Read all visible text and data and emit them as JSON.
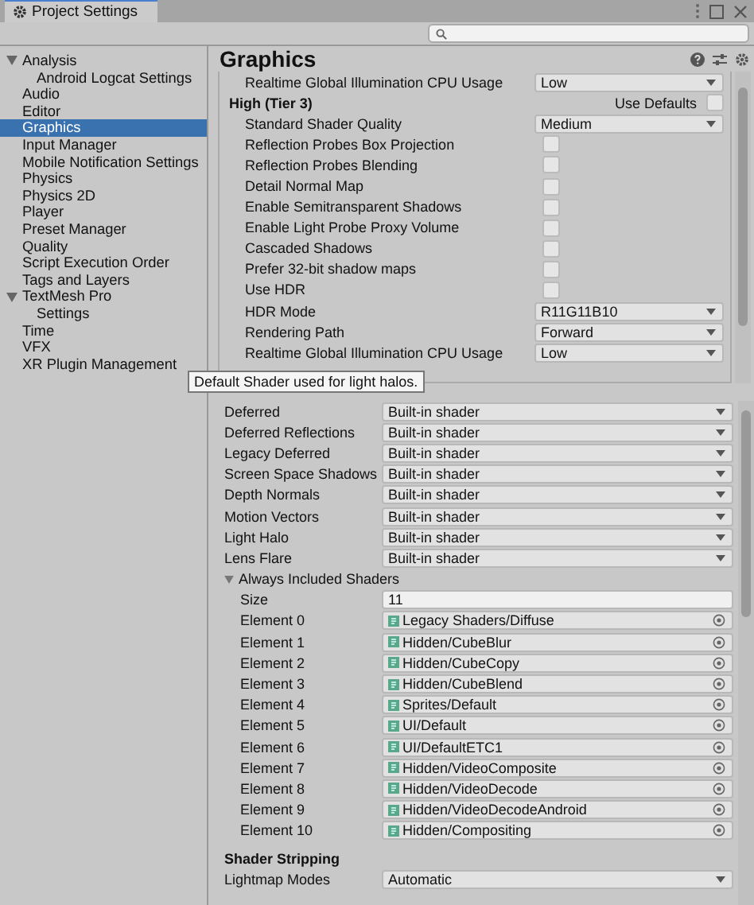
{
  "window": {
    "title": "Project Settings"
  },
  "sidebar": {
    "items": [
      {
        "label": "Analysis",
        "expanded": true,
        "selected": false,
        "children": [
          {
            "label": "Android Logcat Settings",
            "selected": false
          }
        ]
      },
      {
        "label": "Audio",
        "selected": false
      },
      {
        "label": "Editor",
        "selected": false
      },
      {
        "label": "Graphics",
        "selected": true
      },
      {
        "label": "Input Manager",
        "selected": false
      },
      {
        "label": "Mobile Notification Settings",
        "selected": false
      },
      {
        "label": "Physics",
        "selected": false
      },
      {
        "label": "Physics 2D",
        "selected": false
      },
      {
        "label": "Player",
        "selected": false
      },
      {
        "label": "Preset Manager",
        "selected": false
      },
      {
        "label": "Quality",
        "selected": false
      },
      {
        "label": "Script Execution Order",
        "selected": false
      },
      {
        "label": "Tags and Layers",
        "selected": false
      },
      {
        "label": "TextMesh Pro",
        "expanded": true,
        "selected": false,
        "children": [
          {
            "label": "Settings",
            "selected": false
          }
        ]
      },
      {
        "label": "Time",
        "selected": false
      },
      {
        "label": "VFX",
        "selected": false
      },
      {
        "label": "XR Plugin Management",
        "selected": false
      }
    ]
  },
  "page": {
    "title": "Graphics"
  },
  "tier_settings": {
    "rows": [
      {
        "kind": "dropdown",
        "label": "Realtime Global Illumination CPU Usage",
        "value": "Low"
      },
      {
        "kind": "header",
        "label": "High (Tier 3)",
        "defaults_label": "Use Defaults",
        "checked": false
      },
      {
        "kind": "dropdown",
        "label": "Standard Shader Quality",
        "value": "Medium"
      },
      {
        "kind": "checkbox",
        "label": "Reflection Probes Box Projection",
        "checked": false
      },
      {
        "kind": "checkbox",
        "label": "Reflection Probes Blending",
        "checked": false
      },
      {
        "kind": "checkbox",
        "label": "Detail Normal Map",
        "checked": false
      },
      {
        "kind": "checkbox",
        "label": "Enable Semitransparent Shadows",
        "checked": false
      },
      {
        "kind": "checkbox",
        "label": "Enable Light Probe Proxy Volume",
        "checked": false
      },
      {
        "kind": "checkbox",
        "label": "Cascaded Shadows",
        "checked": false
      },
      {
        "kind": "checkbox",
        "label": "Prefer 32-bit shadow maps",
        "checked": false
      },
      {
        "kind": "checkbox",
        "label": "Use HDR",
        "checked": false
      },
      {
        "kind": "dropdown",
        "label": "HDR Mode",
        "value": "R11G11B10"
      },
      {
        "kind": "dropdown",
        "label": "Rendering Path",
        "value": "Forward"
      },
      {
        "kind": "dropdown",
        "label": "Realtime Global Illumination CPU Usage",
        "value": "Low"
      }
    ]
  },
  "tooltip": "Default Shader used for light halos.",
  "builtin_shaders": [
    {
      "label": "Deferred",
      "value": "Built-in shader"
    },
    {
      "label": "Deferred Reflections",
      "value": "Built-in shader"
    },
    {
      "label": "Legacy Deferred",
      "value": "Built-in shader"
    },
    {
      "label": "Screen Space Shadows",
      "value": "Built-in shader"
    },
    {
      "label": "Depth Normals",
      "value": "Built-in shader"
    },
    {
      "label": "Motion Vectors",
      "value": "Built-in shader"
    },
    {
      "label": "Light Halo",
      "value": "Built-in shader"
    },
    {
      "label": "Lens Flare",
      "value": "Built-in shader"
    }
  ],
  "always_included": {
    "label": "Always Included Shaders",
    "expanded": true,
    "size_label": "Size",
    "size": "11",
    "elements": [
      {
        "label": "Element 0",
        "value": "Legacy Shaders/Diffuse"
      },
      {
        "label": "Element 1",
        "value": "Hidden/CubeBlur"
      },
      {
        "label": "Element 2",
        "value": "Hidden/CubeCopy"
      },
      {
        "label": "Element 3",
        "value": "Hidden/CubeBlend"
      },
      {
        "label": "Element 4",
        "value": "Sprites/Default"
      },
      {
        "label": "Element 5",
        "value": "UI/Default"
      },
      {
        "label": "Element 6",
        "value": "UI/DefaultETC1"
      },
      {
        "label": "Element 7",
        "value": "Hidden/VideoComposite"
      },
      {
        "label": "Element 8",
        "value": "Hidden/VideoDecode"
      },
      {
        "label": "Element 9",
        "value": "Hidden/VideoDecodeAndroid"
      },
      {
        "label": "Element 10",
        "value": "Hidden/Compositing"
      }
    ]
  },
  "shader_stripping": {
    "title": "Shader Stripping",
    "rows": [
      {
        "label": "Lightmap Modes",
        "value": "Automatic"
      }
    ]
  }
}
